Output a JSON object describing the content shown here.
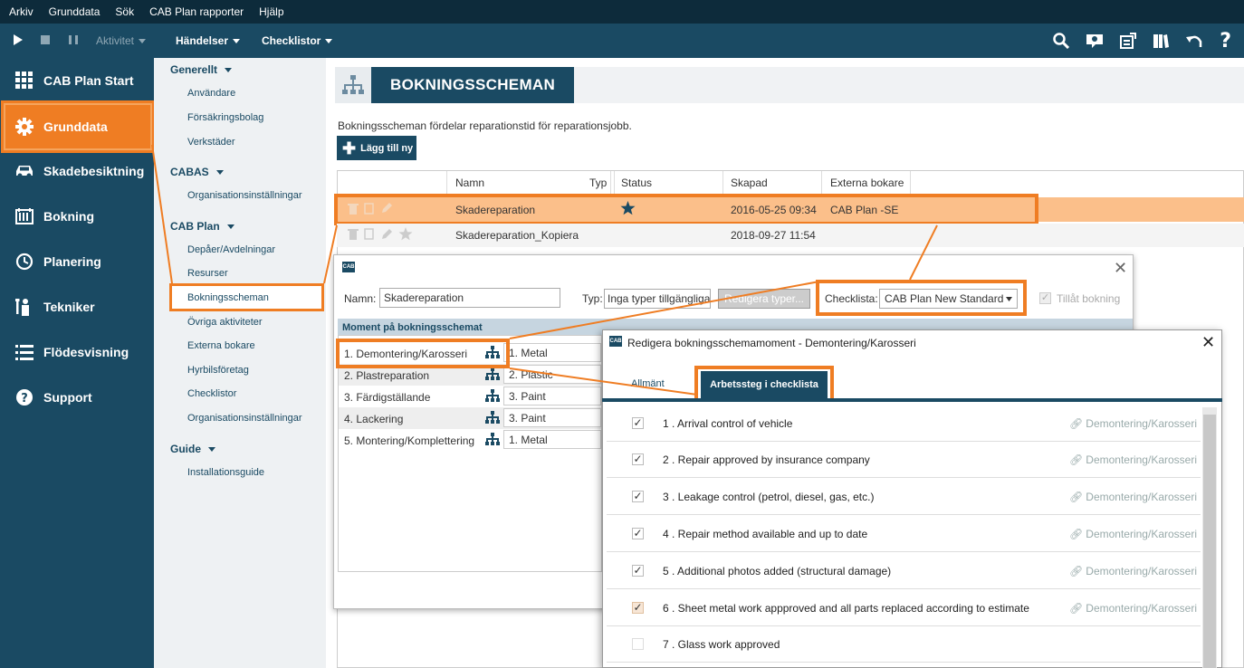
{
  "menubar": {
    "items": [
      "Arkiv",
      "Grunddata",
      "Sök",
      "CAB Plan rapporter",
      "Hjälp"
    ]
  },
  "toolbar": {
    "activity": "Aktivitet",
    "events": "Händelser",
    "checklists": "Checklistor"
  },
  "sidebar": {
    "items": [
      {
        "label": "CAB Plan Start",
        "icon": "grid-icon"
      },
      {
        "label": "Grunddata",
        "icon": "gear-icon",
        "active": true
      },
      {
        "label": "Skadebesiktning",
        "icon": "car-icon"
      },
      {
        "label": "Bokning",
        "icon": "calendar-icon"
      },
      {
        "label": "Planering",
        "icon": "clock-icon"
      },
      {
        "label": "Tekniker",
        "icon": "technician-icon"
      },
      {
        "label": "Flödesvisning",
        "icon": "list-icon"
      },
      {
        "label": "Support",
        "icon": "help-icon"
      }
    ]
  },
  "submenu": {
    "sections": [
      {
        "title": "Generellt",
        "items": [
          "Användare",
          "Försäkringsbolag",
          "Verkstäder"
        ]
      },
      {
        "title": "CABAS",
        "items": [
          "Organisationsinställningar"
        ]
      },
      {
        "title": "CAB Plan",
        "items": [
          "Depåer/Avdelningar",
          "Resurser",
          "Bokningsscheman",
          "Övriga aktiviteter",
          "Externa bokare",
          "Hyrbilsföretag",
          "Checklistor",
          "Organisationsinställningar"
        ]
      },
      {
        "title": "Guide",
        "items": [
          "Installationsguide"
        ]
      }
    ]
  },
  "page": {
    "title": "BOKNINGSSCHEMAN",
    "description": "Bokningsscheman fördelar reparationstid för reparationsjobb.",
    "add_button": "Lägg till ny"
  },
  "table": {
    "columns": [
      "Namn",
      "Typ",
      "Status",
      "Skapad",
      "Externa bokare"
    ],
    "rows": [
      {
        "name": "Skadereparation",
        "type": "",
        "created": "2016-05-25 09:34",
        "external": "CAB Plan -SE"
      },
      {
        "name": "Skadereparation_Kopiera",
        "type": "",
        "created": "2018-09-27 11:54",
        "external": ""
      }
    ]
  },
  "dialog1": {
    "logo": "CAB",
    "name_label": "Namn:",
    "name_value": "Skadereparation",
    "type_label": "Typ:",
    "type_value": "Inga typer tillgängliga",
    "edit_types": "Redigera typer...",
    "checklist_label": "Checklista:",
    "checklist_value": "CAB Plan New Standard",
    "allow_booking": "Tillåt bokning",
    "moments_header": "Moment på bokningsschemat",
    "moments": [
      {
        "name": "1. Demontering/Karosseri",
        "category": "1. Metal"
      },
      {
        "name": "2. Plastreparation",
        "category": "2. Plastic"
      },
      {
        "name": "3. Färdigställande",
        "category": "3. Paint"
      },
      {
        "name": "4. Lackering",
        "category": "3. Paint"
      },
      {
        "name": "5. Montering/Komplettering",
        "category": "1. Metal"
      }
    ]
  },
  "dialog2": {
    "title": "Redigera bokningsschemamoment - Demontering/Karosseri",
    "tabs": [
      "Allmänt",
      "Arbetssteg i checklista"
    ],
    "link_label": "Demontering/Karosseri",
    "checklist": [
      {
        "label": "1 . Arrival control of vehicle",
        "checked": true
      },
      {
        "label": "2 . Repair approved by insurance company",
        "checked": true
      },
      {
        "label": "3 . Leakage control (petrol, diesel, gas, etc.)",
        "checked": true
      },
      {
        "label": "4 . Repair method available and up to date",
        "checked": true
      },
      {
        "label": "5 . Additional photos added (structural damage)",
        "checked": true
      },
      {
        "label": "6 . Sheet metal work appproved and all parts replaced according to estimate",
        "checked": true
      },
      {
        "label": "7 . Glass work approved",
        "checked": false
      }
    ]
  },
  "colors": {
    "navy": "#1a4a63",
    "dark": "#0d2b3b",
    "accent": "#ef7d23",
    "highlight": "#fbbf8a"
  }
}
